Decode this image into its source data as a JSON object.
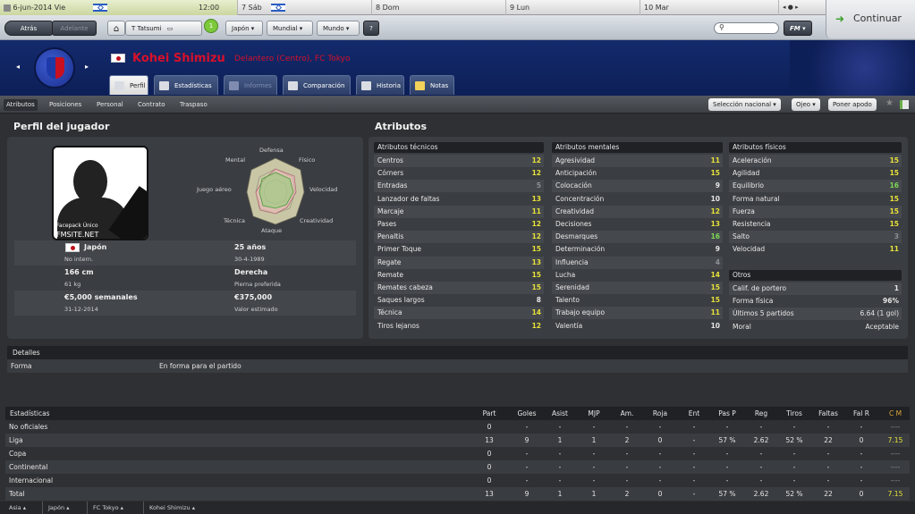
{
  "calendar": {
    "date": "6-jun-2014",
    "weekday": "Vie",
    "time": "12:00",
    "days": [
      "7 Sáb",
      "8 Dom",
      "9 Lun",
      "10 Mar"
    ]
  },
  "nav": {
    "back": "Atrás",
    "forward": "Adelante",
    "manager": "T Tatsumi",
    "badge": "1",
    "dd1": "Japón",
    "dd2": "Mundial",
    "dd3": "Mundo",
    "help": "?",
    "fm": "FM",
    "continue": "Continuar"
  },
  "player": {
    "name": "Kohei Shimizu",
    "role": "Delantero (Centro), FC Tokyo"
  },
  "tabs": [
    "Perfil",
    "Estadísticas",
    "Informes",
    "Comparación",
    "Historia",
    "Notas"
  ],
  "subtabs": [
    "Atributos",
    "Posiciones",
    "Personal",
    "Contrato",
    "Traspaso"
  ],
  "right_buttons": [
    "Selección nacional",
    "Ojeo",
    "Poner apodo"
  ],
  "profile": {
    "title": "Perfil del jugador",
    "photo_caption1": "Facepack Único",
    "photo_caption2": "FMSITE.NET",
    "radar": {
      "top": "Defensa",
      "tl": "Mental",
      "tr": "Físico",
      "l": "Juego aéreo",
      "r": "Velocidad",
      "bl": "Técnica",
      "br": "Creatividad",
      "b": "Ataque"
    },
    "nation": "Japón",
    "nation_sub": "No intern.",
    "age": "25 años",
    "dob": "30-4-1989",
    "height": "166 cm",
    "weight": "61 kg",
    "foot": "Derecha",
    "foot_sub": "Pierna preferida",
    "wage": "€5,000 semanales",
    "contract": "31-12-2014",
    "value": "€375,000",
    "value_sub": "Valor estimado"
  },
  "attrs_title": "Atributos",
  "technical": {
    "title": "Atributos técnicos",
    "rows": [
      [
        "Centros",
        "12",
        "y"
      ],
      [
        "Córners",
        "12",
        "y"
      ],
      [
        "Entradas",
        "5",
        "gr"
      ],
      [
        "Lanzador de faltas",
        "13",
        "y"
      ],
      [
        "Marcaje",
        "11",
        "y"
      ],
      [
        "Pases",
        "12",
        "y"
      ],
      [
        "Penaltis",
        "12",
        "y"
      ],
      [
        "Primer Toque",
        "15",
        "y"
      ],
      [
        "Regate",
        "13",
        "y"
      ],
      [
        "Remate",
        "15",
        "y"
      ],
      [
        "Remates cabeza",
        "15",
        "y"
      ],
      [
        "Saques largos",
        "8",
        "w"
      ],
      [
        "Técnica",
        "14",
        "y"
      ],
      [
        "Tiros lejanos",
        "12",
        "y"
      ]
    ]
  },
  "mental": {
    "title": "Atributos mentales",
    "rows": [
      [
        "Agresividad",
        "11",
        "y"
      ],
      [
        "Anticipación",
        "15",
        "y"
      ],
      [
        "Colocación",
        "9",
        "w"
      ],
      [
        "Concentración",
        "10",
        "w"
      ],
      [
        "Creatividad",
        "12",
        "y"
      ],
      [
        "Decisiones",
        "13",
        "y"
      ],
      [
        "Desmarques",
        "16",
        "g"
      ],
      [
        "Determinación",
        "9",
        "w"
      ],
      [
        "Influencia",
        "4",
        "gr"
      ],
      [
        "Lucha",
        "14",
        "y"
      ],
      [
        "Serenidad",
        "15",
        "y"
      ],
      [
        "Talento",
        "15",
        "y"
      ],
      [
        "Trabajo equipo",
        "11",
        "y"
      ],
      [
        "Valentía",
        "10",
        "w"
      ]
    ]
  },
  "physical": {
    "title": "Atributos físicos",
    "rows": [
      [
        "Aceleración",
        "15",
        "y"
      ],
      [
        "Agilidad",
        "15",
        "y"
      ],
      [
        "Equilibrio",
        "16",
        "g"
      ],
      [
        "Forma natural",
        "15",
        "y"
      ],
      [
        "Fuerza",
        "15",
        "y"
      ],
      [
        "Resistencia",
        "15",
        "y"
      ],
      [
        "Salto",
        "3",
        "gr"
      ],
      [
        "Velocidad",
        "11",
        "y"
      ]
    ]
  },
  "others": {
    "title": "Otros",
    "rows": [
      [
        "Calif. de portero",
        "1"
      ],
      [
        "Forma física",
        "96%"
      ],
      [
        "Últimos 5 partidos",
        "6.64 (1 gol)"
      ],
      [
        "Moral",
        "Aceptable"
      ]
    ]
  },
  "details": {
    "title": "Detalles",
    "label": "Forma",
    "value": "En forma para el partido"
  },
  "stats": {
    "title": "Estadísticas",
    "headers": [
      "Part",
      "Goles",
      "Asist",
      "MJP",
      "Am.",
      "Roja",
      "Ent",
      "Pas P",
      "Reg",
      "Tiros",
      "Faltas",
      "Fal R",
      "C M"
    ],
    "rows": [
      [
        "No oficiales",
        "0",
        "-",
        "-",
        "-",
        "-",
        "-",
        "-",
        "-",
        "-",
        "-",
        "-",
        "-",
        "----"
      ],
      [
        "Liga",
        "13",
        "9",
        "1",
        "1",
        "2",
        "0",
        "-",
        "57 %",
        "2.62",
        "52 %",
        "22",
        "0",
        "7.15"
      ],
      [
        "Copa",
        "0",
        "-",
        "-",
        "-",
        "-",
        "-",
        "-",
        "-",
        "-",
        "-",
        "-",
        "-",
        "----"
      ],
      [
        "Continental",
        "0",
        "-",
        "-",
        "-",
        "-",
        "-",
        "-",
        "-",
        "-",
        "-",
        "-",
        "-",
        "----"
      ],
      [
        "Internacional",
        "0",
        "-",
        "-",
        "-",
        "-",
        "-",
        "-",
        "-",
        "-",
        "-",
        "-",
        "-",
        "----"
      ],
      [
        "Total",
        "13",
        "9",
        "1",
        "1",
        "2",
        "0",
        "-",
        "57 %",
        "2.62",
        "52 %",
        "22",
        "0",
        "7.15"
      ]
    ]
  },
  "footer": [
    "Asia",
    "Japón",
    "FC Tokyo",
    "Kohei Shimizu"
  ]
}
